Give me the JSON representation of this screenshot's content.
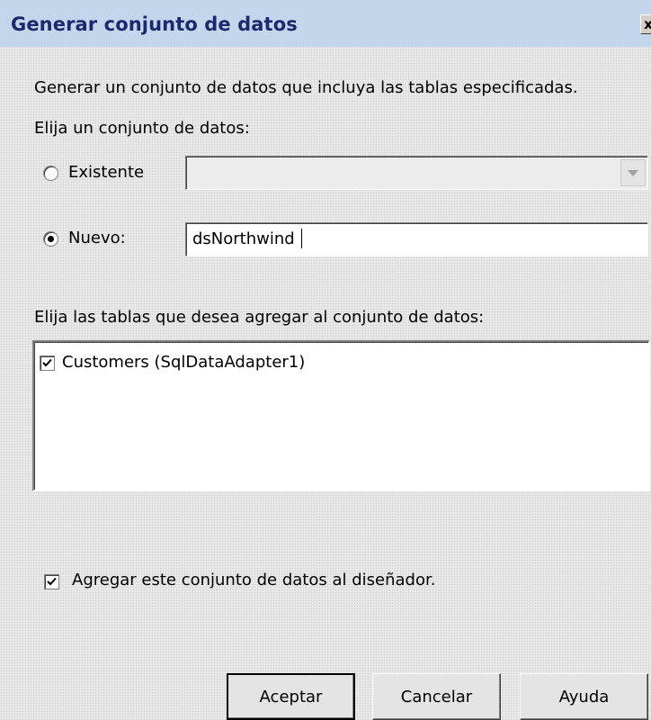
{
  "window": {
    "title": "Generar conjunto de datos",
    "close_label": "x"
  },
  "description": "Generar un conjunto de datos que incluya las tablas especificadas.",
  "choose_dataset_label": "Elija un conjunto de datos:",
  "existing": {
    "label": "Existente",
    "selected": false,
    "value": ""
  },
  "new": {
    "label": "Nuevo:",
    "selected": true,
    "value": "dsNorthwind"
  },
  "tables_label": "Elija las tablas que desea agregar al conjunto de datos:",
  "tables": [
    {
      "label": "Customers (SqlDataAdapter1)",
      "checked": true
    }
  ],
  "add_to_designer": {
    "label": "Agregar este conjunto de datos al diseñador.",
    "checked": true
  },
  "buttons": {
    "ok": "Aceptar",
    "cancel": "Cancelar",
    "help": "Ayuda"
  }
}
